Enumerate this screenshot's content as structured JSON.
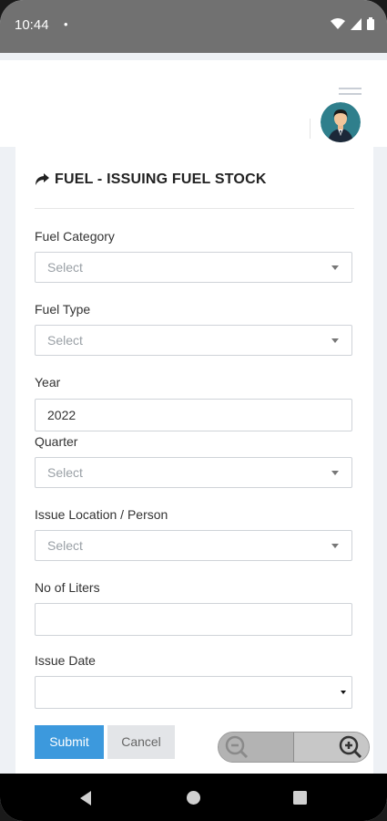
{
  "status_bar": {
    "time": "10:44",
    "dot": "•"
  },
  "app_bar": {
    "menu_icon": "hamburger-icon",
    "avatar": "user-avatar"
  },
  "page": {
    "title": "FUEL - ISSUING FUEL STOCK",
    "title_icon": "share-arrow-icon"
  },
  "form": {
    "fuel_category": {
      "label": "Fuel Category",
      "placeholder": "Select"
    },
    "fuel_type": {
      "label": "Fuel Type",
      "placeholder": "Select"
    },
    "year": {
      "label": "Year",
      "value": "2022"
    },
    "quarter": {
      "label": "Quarter",
      "placeholder": "Select"
    },
    "issue_location": {
      "label": "Issue Location / Person",
      "placeholder": "Select"
    },
    "liters": {
      "label": "No of Liters",
      "value": ""
    },
    "issue_date": {
      "label": "Issue Date",
      "value": ""
    }
  },
  "buttons": {
    "submit": "Submit",
    "cancel": "Cancel"
  },
  "zoom": {
    "out_icon": "zoom-out-icon",
    "in_icon": "zoom-in-icon"
  },
  "colors": {
    "primary": "#3c99dd",
    "status_bar": "#717171",
    "background": "#eef1f5"
  }
}
